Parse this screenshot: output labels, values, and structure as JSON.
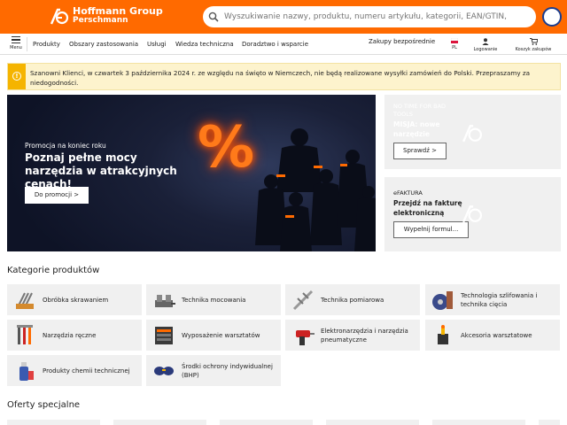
{
  "header": {
    "brand_line1": "Hoffmann Group",
    "brand_line2": "Perschmann",
    "search_placeholder": "Wyszukiwanie nazwy, produktu, numeru artykułu, kategorii, EAN/GTIN, marki...",
    "colors": {
      "accent": "#ff6a00",
      "dark": "#0e1326",
      "notice_bg": "#fdf3cd",
      "notice_icon": "#f5b400"
    }
  },
  "nav": {
    "menu_label": "Menu",
    "items": [
      "Produkty",
      "Obszary zastosowania",
      "Usługi",
      "Wiedza techniczna",
      "Doradztwo i wsparcie"
    ],
    "quick_order": "Zakupy bezpośrednie",
    "language": "PL",
    "login": "Logowanie",
    "cart": "Koszyk zakupów"
  },
  "notice": {
    "text": "Szanowni Klienci, w czwartek 3 października 2024 r. ze względu na święto w Niemczech, nie będą realizowane wysyłki zamówień do Polski. Przepraszamy za niedogodności."
  },
  "hero": {
    "eyebrow": "Promocja na koniec roku",
    "title": "Poznaj pełne mocy narzędzia w atrakcyjnych cenach!",
    "button": "Do promocji >"
  },
  "side_cards": [
    {
      "eyebrow": "NO TIME FOR BAD TOOLS",
      "title": "MISJA: nowe narzędzie",
      "button": "Sprawdź >"
    },
    {
      "eyebrow": "eFAKTURA",
      "title": "Przejdź na fakturę elektroniczną",
      "button": "Wypełnij formul..."
    }
  ],
  "categories": {
    "title": "Kategorie produktów",
    "items": [
      {
        "label": "Obróbka skrawaniem",
        "icon": "drill-bits-icon"
      },
      {
        "label": "Technika mocowania",
        "icon": "vise-icon"
      },
      {
        "label": "Technika pomiarowa",
        "icon": "caliper-icon"
      },
      {
        "label": "Technologia szlifowania i technika cięcia",
        "icon": "grinding-disc-icon"
      },
      {
        "label": "Narzędzia ręczne",
        "icon": "hand-tools-icon"
      },
      {
        "label": "Wyposażenie warsztatów",
        "icon": "workshop-cabinet-icon"
      },
      {
        "label": "Elektronarzędzia i narzędzia pneumatyczne",
        "icon": "power-drill-icon"
      },
      {
        "label": "Akcesoria warsztatowe",
        "icon": "workshop-accessories-icon"
      },
      {
        "label": "Produkty chemii technicznej",
        "icon": "spray-can-icon"
      },
      {
        "label": "Środki ochrony indywidualnej (BHP)",
        "icon": "safety-glasses-icon"
      }
    ]
  },
  "offers": {
    "title": "Oferty specjalne"
  }
}
